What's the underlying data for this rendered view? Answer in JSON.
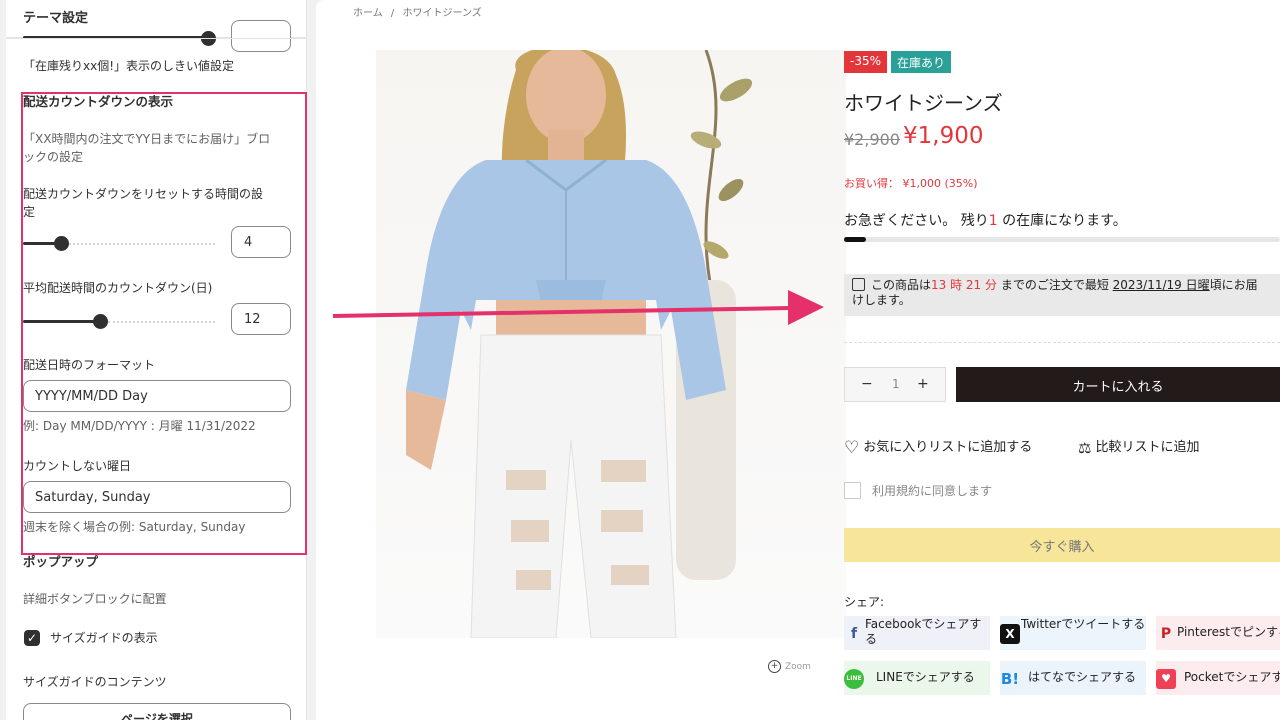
{
  "panel": {
    "title": "テーマ設定",
    "stock_threshold_note": "「在庫残りxx個!」表示のしきい値設定",
    "countdown_heading": "配送カウントダウンの表示",
    "countdown_desc_line1": "「XX時間内の注文でYY日までにお届け」ブロ",
    "countdown_desc_line2": "ックの設定",
    "reset_label_line1": "配送カウントダウンをリセットする時間の設",
    "reset_label_line2": "定",
    "reset_value": "4",
    "reset_slider_fraction": 0.2,
    "avg_label": "平均配送時間のカウントダウン(日)",
    "avg_value": "12",
    "avg_slider_fraction": 0.4,
    "format_label": "配送日時のフォーマット",
    "format_value": "YYYY/MM/DD Day",
    "format_example": "例: Day MM/DD/YYYY : 月曜 11/31/2022",
    "skip_days_label": "カウントしない曜日",
    "skip_days_value": "Saturday, Sunday",
    "skip_days_example": "週末を除く場合の例: Saturday, Sunday",
    "popup_heading": "ポップアップ",
    "popup_desc": "詳細ボタンブロックに配置",
    "size_guide_checkbox": "サイズガイドの表示",
    "size_guide_checked": true,
    "size_guide_content_label": "サイズガイドのコンテンツ",
    "select_page_button": "ページを選択"
  },
  "preview": {
    "breadcrumb_home": "ホーム",
    "breadcrumb_sep": "/",
    "breadcrumb_current": "ホワイトジーンズ",
    "zoom_label": "Zoom",
    "badge_discount": "-35%",
    "badge_stock": "在庫あり",
    "title": "ホワイトジーンズ",
    "old_price": "¥2,900",
    "new_price": "¥1,900",
    "savings": "お買い得： ¥1,000 (35%)",
    "stock_pre": "お急ぎください。 残り",
    "stock_count": "1",
    "stock_post": " の在庫になります。",
    "stock_fraction": 0.05,
    "ship_pre": "この商品は",
    "ship_time": "13 時 21 分",
    "ship_mid": " までのご注文で最短 ",
    "ship_date": "2023/11/19 日曜",
    "ship_post": "頃にお届",
    "ship_line2": "けします。",
    "qty_minus": "−",
    "qty_value": "1",
    "qty_plus": "+",
    "cart_button": "カートに入れる",
    "wishlist": "お気に入りリストに追加する",
    "compare": "比較リストに追加",
    "terms": "利用規約に同意します",
    "buy_now": "今すぐ購入",
    "share_label": "シェア:",
    "share_facebook": "Facebookでシェアする",
    "share_twitter": "Twitterでツイートする",
    "share_pinterest": "Pinterestでピンする",
    "share_line": "LINEでシェアする",
    "share_hatena": "はてなでシェアする",
    "share_pocket": "Pocketでシェアする",
    "hatena_icon_text": "B!",
    "line_icon_text": "LINE"
  },
  "colors": {
    "highlight": "#e4306b",
    "sale_red": "#e2363b",
    "stock_green": "#2aa198",
    "cart_dark": "#231a1a",
    "buy_yellow": "#f7e59a"
  }
}
